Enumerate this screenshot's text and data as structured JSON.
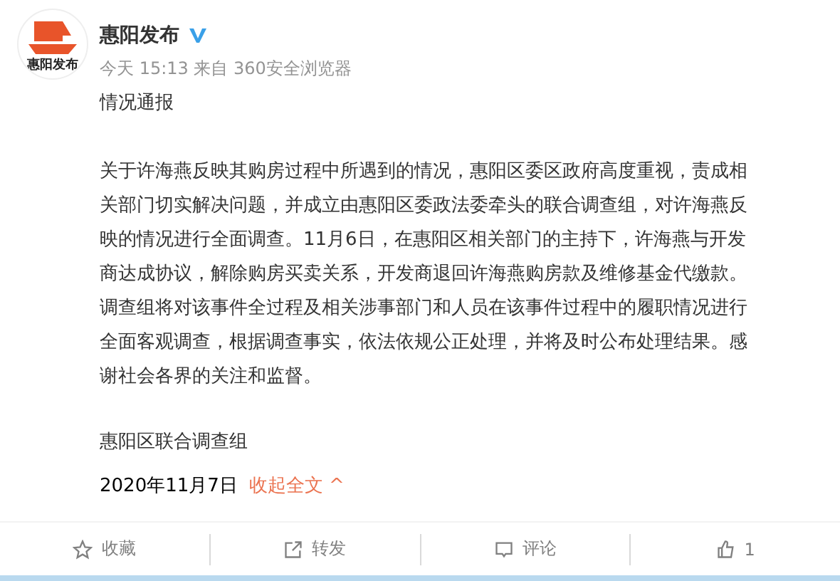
{
  "post": {
    "author": "惠阳发布",
    "verified": true,
    "avatar_text": "惠阳发布",
    "meta": "今天 15:13 来自 360安全浏览器",
    "title": "情况通报",
    "body": "关于许海燕反映其购房过程中所遇到的情况，惠阳区委区政府高度重视，责成相关部门切实解决问题，并成立由惠阳区委政法委牵头的联合调查组，对许海燕反映的情况进行全面调查。11月6日，在惠阳区相关部门的主持下，许海燕与开发商达成协议，解除购房买卖关系，开发商退回许海燕购房款及维修基金代缴款。调查组将对该事件全过程及相关涉事部门和人员在该事件过程中的履职情况进行全面客观调查，根据调查事实，依法依规公正处理，并将及时公布处理结果。感谢社会各界的关注和监督。",
    "signature": "惠阳区联合调查组",
    "date": "2020年11月7日",
    "collapse": "收起全文 ^"
  },
  "actions": [
    {
      "kind": "favorite",
      "label": "收藏"
    },
    {
      "kind": "repost",
      "label": "转发"
    },
    {
      "kind": "comment",
      "label": "评论"
    },
    {
      "kind": "like",
      "label": "1"
    }
  ]
}
